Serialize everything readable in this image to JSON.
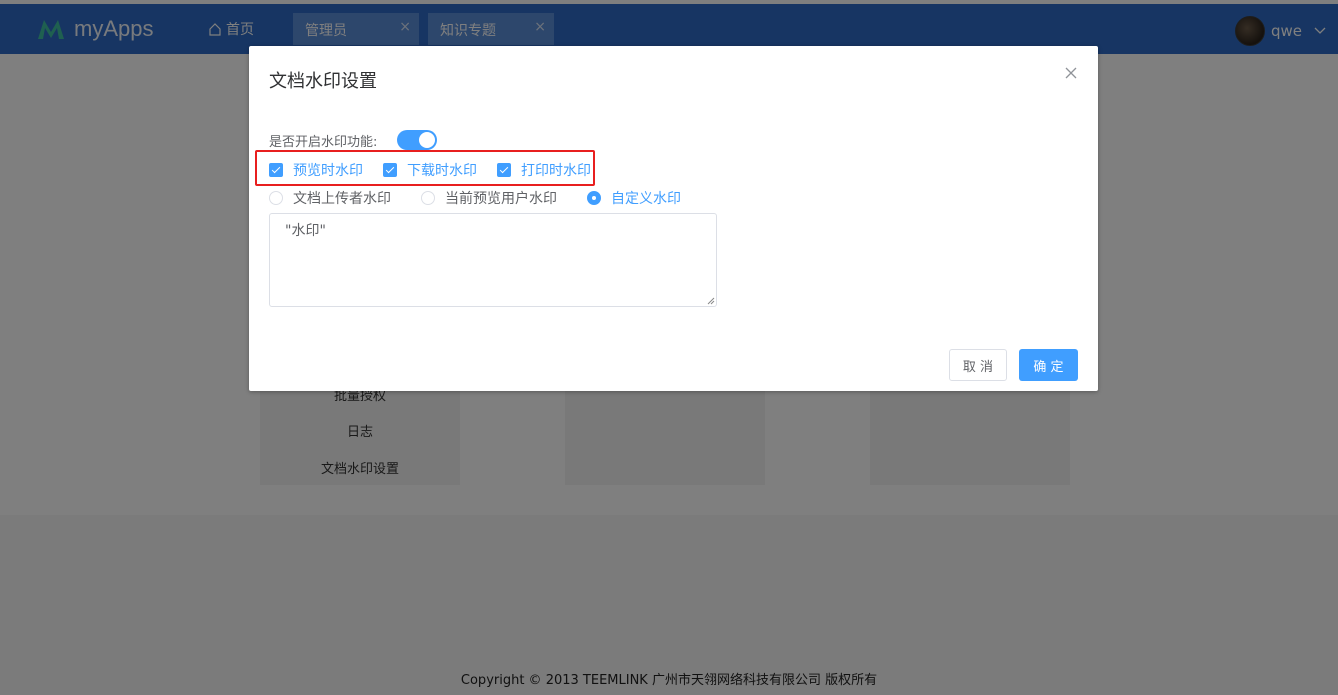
{
  "header": {
    "app_name": "myApps",
    "home_label": "首页",
    "tabs": [
      {
        "label": "管理员",
        "close": "×"
      },
      {
        "label": "知识专题",
        "close": "×"
      }
    ],
    "user_name": "qwe"
  },
  "sidebar_card": {
    "items": [
      "批量授权",
      "日志",
      "文档水印设置"
    ]
  },
  "footer": {
    "copyright": "Copyright © 2013 TEEMLINK 广州市天翎网络科技有限公司 版权所有"
  },
  "dialog": {
    "title": "文档水印设置",
    "switch_label": "是否开启水印功能:",
    "switch_on": true,
    "checkboxes": [
      {
        "label": "预览时水印",
        "checked": true
      },
      {
        "label": "下载时水印",
        "checked": true
      },
      {
        "label": "打印时水印",
        "checked": true
      }
    ],
    "radios": [
      {
        "label": "文档上传者水印",
        "checked": false
      },
      {
        "label": "当前预览用户水印",
        "checked": false
      },
      {
        "label": "自定义水印",
        "checked": true
      }
    ],
    "textarea_value": "\"水印\"",
    "cancel_label": "取 消",
    "ok_label": "确 定"
  },
  "colors": {
    "header_bg": "#2e6bc6",
    "primary": "#409eff",
    "highlight_border": "#e81f1f"
  }
}
